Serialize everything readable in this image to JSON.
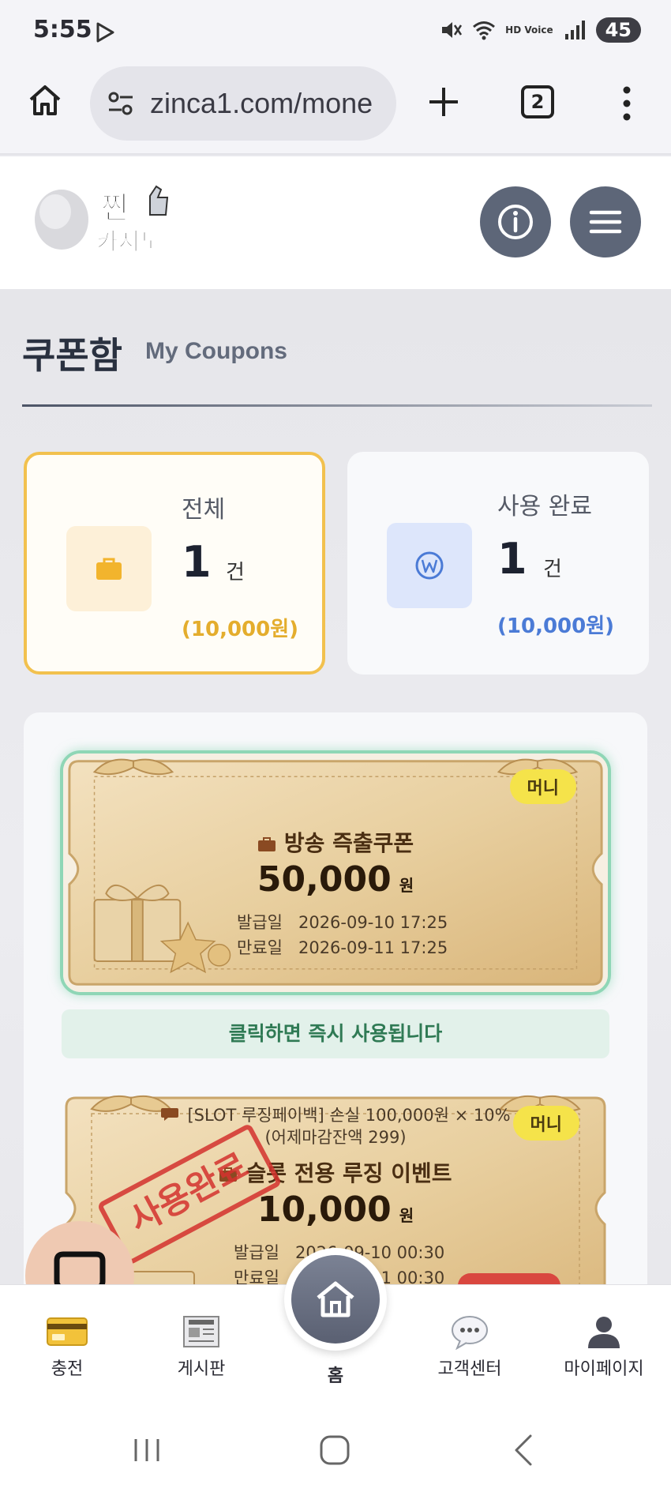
{
  "status_bar": {
    "time": "5:55",
    "battery": "45",
    "icons": [
      "play-store-icon",
      "mute-icon",
      "wifi-icon",
      "hd-voice-icon",
      "signal-icon"
    ],
    "hd_voice_label": "HD Voice"
  },
  "browser": {
    "url": "zinca1.com/mone",
    "tab_count": "2",
    "icons": [
      "home-icon",
      "site-settings-icon",
      "plus-icon",
      "tabs-icon",
      "more-menu-icon"
    ]
  },
  "header": {
    "logo_text": "찐 카지노",
    "info_icon": "info-icon",
    "menu_icon": "hamburger-icon"
  },
  "page": {
    "title": "쿠폰함",
    "subtitle": "My Coupons"
  },
  "stats": {
    "total": {
      "label": "전체",
      "count": "1",
      "unit": "건",
      "amount": "(10,000원)",
      "icon": "briefcase-icon",
      "color": "#f2c14e"
    },
    "used": {
      "label": "사용 완료",
      "count": "1",
      "unit": "건",
      "amount": "(10,000원)",
      "icon": "won-icon",
      "color": "#4b7bd6"
    }
  },
  "coupons": [
    {
      "badge": "머니",
      "name": "방송 즉출쿠폰",
      "amount": "50,000",
      "currency": "원",
      "issue_label": "발급일",
      "issue_date": "2026-09-10 17:25",
      "expire_label": "만료일",
      "expire_date": "2026-09-11 17:25",
      "hint": "클릭하면 즉시 사용됩니다"
    },
    {
      "badge": "머니",
      "desc_line1": "[SLOT 루징페이백] 손실 100,000원 × 10%",
      "desc_line2": "(어제마감잔액 299)",
      "name": "슬롯 전용 루징 이벤트",
      "amount": "10,000",
      "currency": "원",
      "issue_label": "발급일",
      "issue_date": "2026-09-10 00:30",
      "expire_label": "만료일",
      "expire_date": "2026-09-11 00:30",
      "stamp": "사용완료"
    }
  ],
  "bottom_nav": {
    "items": [
      {
        "label": "충전",
        "icon": "credit-card-icon"
      },
      {
        "label": "게시판",
        "icon": "newspaper-icon"
      },
      {
        "label": "홈",
        "icon": "home-icon"
      },
      {
        "label": "고객센터",
        "icon": "speech-bubble-icon"
      },
      {
        "label": "마이페이지",
        "icon": "user-icon"
      }
    ]
  },
  "colors": {
    "accent_gold": "#f2c14e",
    "accent_blue": "#4b7bd6",
    "active_border": "#8fd6b6",
    "stamp_red": "#d4322e",
    "header_button": "#5d6678"
  }
}
